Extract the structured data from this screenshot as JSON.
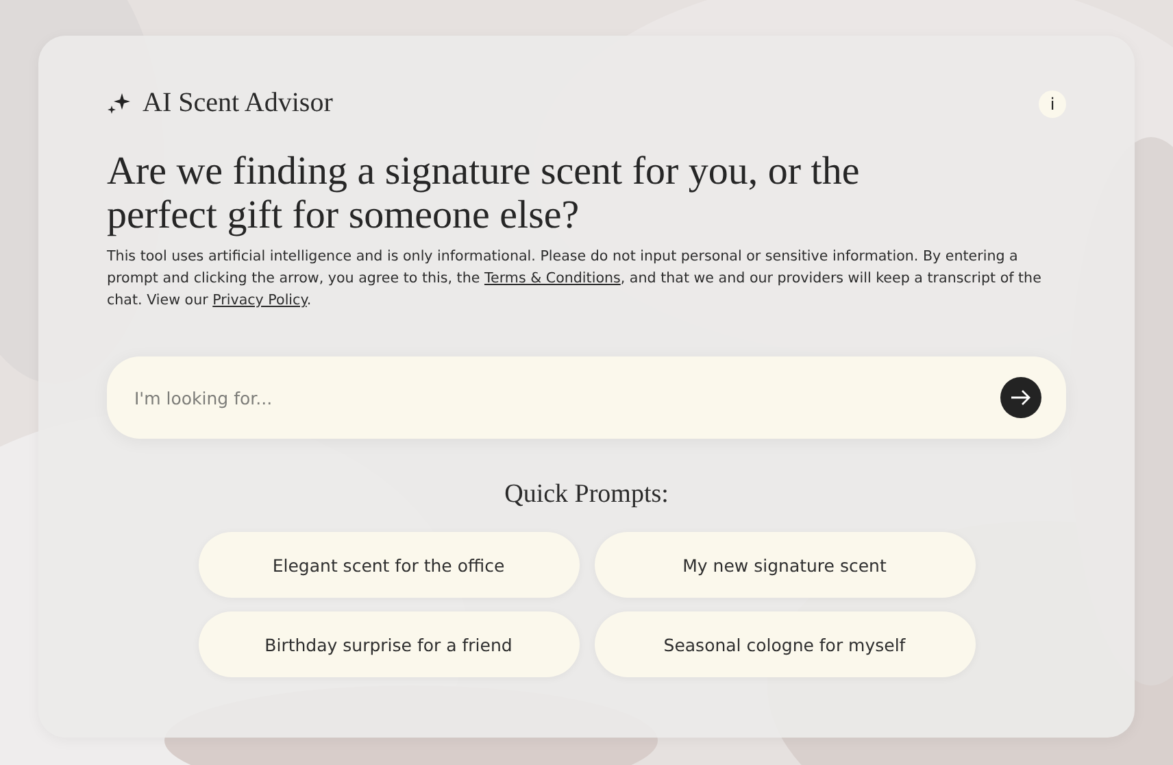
{
  "header": {
    "title": "AI Scent Advisor",
    "info_button": "i"
  },
  "headline": "Are we finding a signature scent for you, or the perfect gift for someone else?",
  "disclaimer": {
    "before": "This tool uses artificial intelligence and is only informational. Please do not input personal or sensitive information. By entering a prompt and clicking the arrow, you agree to this, the ",
    "terms_link": "Terms & Conditions",
    "middle": ", and that we and our providers will keep a transcript of the chat. View our ",
    "privacy_link": "Privacy Policy",
    "after": "."
  },
  "search": {
    "placeholder": "I'm looking for..."
  },
  "quick_prompts": {
    "title": "Quick Prompts:",
    "items": [
      "Elegant scent for the office",
      "My new signature scent",
      "Birthday surprise for a friend",
      "Seasonal cologne for myself"
    ]
  }
}
